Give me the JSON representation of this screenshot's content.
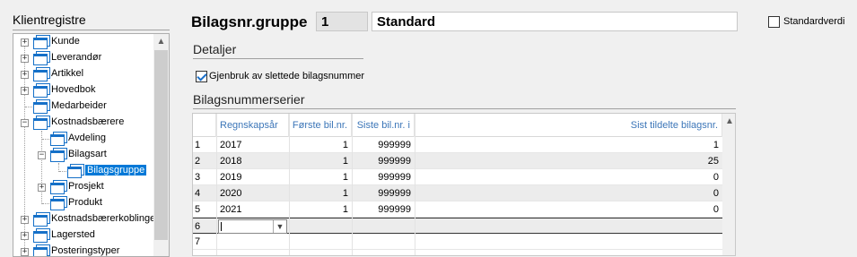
{
  "left_panel": {
    "title": "Klientregistre",
    "tree": [
      {
        "label": "Kunde",
        "level": 0,
        "expander": "+"
      },
      {
        "label": "Leverandør",
        "level": 0,
        "expander": "+"
      },
      {
        "label": "Artikkel",
        "level": 0,
        "expander": "+"
      },
      {
        "label": "Hovedbok",
        "level": 0,
        "expander": "+"
      },
      {
        "label": "Medarbeider",
        "level": 0,
        "expander": ""
      },
      {
        "label": "Kostnadsbærere",
        "level": 0,
        "expander": "-"
      },
      {
        "label": "Avdeling",
        "level": 1,
        "expander": ""
      },
      {
        "label": "Bilagsart",
        "level": 1,
        "expander": "-"
      },
      {
        "label": "Bilagsgruppe",
        "level": 2,
        "expander": "",
        "selected": true
      },
      {
        "label": "Prosjekt",
        "level": 1,
        "expander": "+"
      },
      {
        "label": "Produkt",
        "level": 1,
        "expander": ""
      },
      {
        "label": "Kostnadsbærerkoblinger",
        "level": 0,
        "expander": "+"
      },
      {
        "label": "Lagersted",
        "level": 0,
        "expander": "+"
      },
      {
        "label": "Posteringstyper",
        "level": 0,
        "expander": "+"
      }
    ]
  },
  "header": {
    "label": "Bilagsnr.gruppe",
    "number": "1",
    "name": "Standard",
    "standard_label": "Standardverdi"
  },
  "details": {
    "title": "Detaljer",
    "reuse_label": "Gjenbruk av slettede bilagsnummer",
    "reuse_checked": true
  },
  "series": {
    "title": "Bilagsnummerserier",
    "columns": [
      "Regnskapsår",
      "Første bil.nr.",
      "Siste bil.nr. i",
      "Sist tildelte bilagsnr."
    ],
    "rows": [
      {
        "num": "1",
        "year": "2017",
        "first": "1",
        "last": "999999",
        "assigned": "1"
      },
      {
        "num": "2",
        "year": "2018",
        "first": "1",
        "last": "999999",
        "assigned": "25"
      },
      {
        "num": "3",
        "year": "2019",
        "first": "1",
        "last": "999999",
        "assigned": "0"
      },
      {
        "num": "4",
        "year": "2020",
        "first": "1",
        "last": "999999",
        "assigned": "0"
      },
      {
        "num": "5",
        "year": "2021",
        "first": "1",
        "last": "999999",
        "assigned": "0"
      },
      {
        "num": "6",
        "year": "",
        "first": "",
        "last": "",
        "assigned": ""
      },
      {
        "num": "7",
        "year": "",
        "first": "",
        "last": "",
        "assigned": ""
      }
    ]
  },
  "icons": {
    "folder": "folder-icon",
    "scroll_up": "▲",
    "dropdown": "▼"
  },
  "colors": {
    "accent": "#0078d7",
    "folder": "#1570c8",
    "header_text": "#3c76b8"
  }
}
